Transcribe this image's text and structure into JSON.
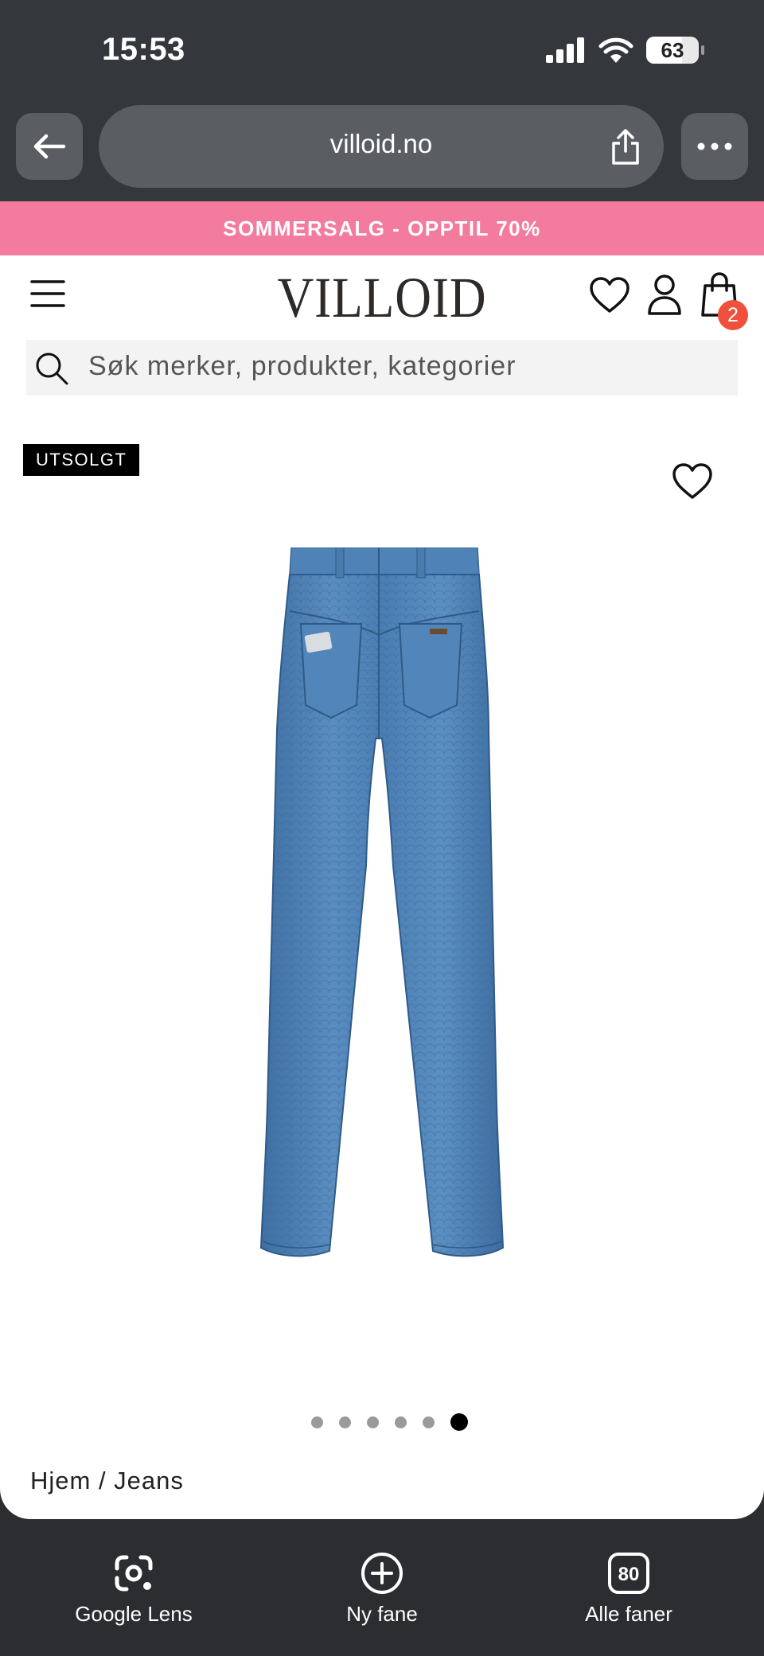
{
  "status_bar": {
    "time": "15:53",
    "battery": "63"
  },
  "browser": {
    "url": "villoid.no"
  },
  "promo": {
    "text": "SOMMERSALG - OPPTIL 70%"
  },
  "header": {
    "logo": "VILLOID",
    "cart_count": "2"
  },
  "search": {
    "placeholder": "Søk merker, produkter, kategorier"
  },
  "product": {
    "badge": "UTSOLGT",
    "image_count": 6,
    "active_image": 6
  },
  "breadcrumb": {
    "text": "Hjem / Jeans"
  },
  "bottom_bar": {
    "items": [
      {
        "label": "Google Lens",
        "icon": "google-lens-icon"
      },
      {
        "label": "Ny fane",
        "icon": "new-tab-icon"
      },
      {
        "label": "Alle faner",
        "icon": "tabs-icon",
        "count": "80"
      }
    ]
  },
  "colors": {
    "promo": "#f27b9e",
    "badge": "#f04f3b",
    "browser_chrome": "#34373b"
  }
}
